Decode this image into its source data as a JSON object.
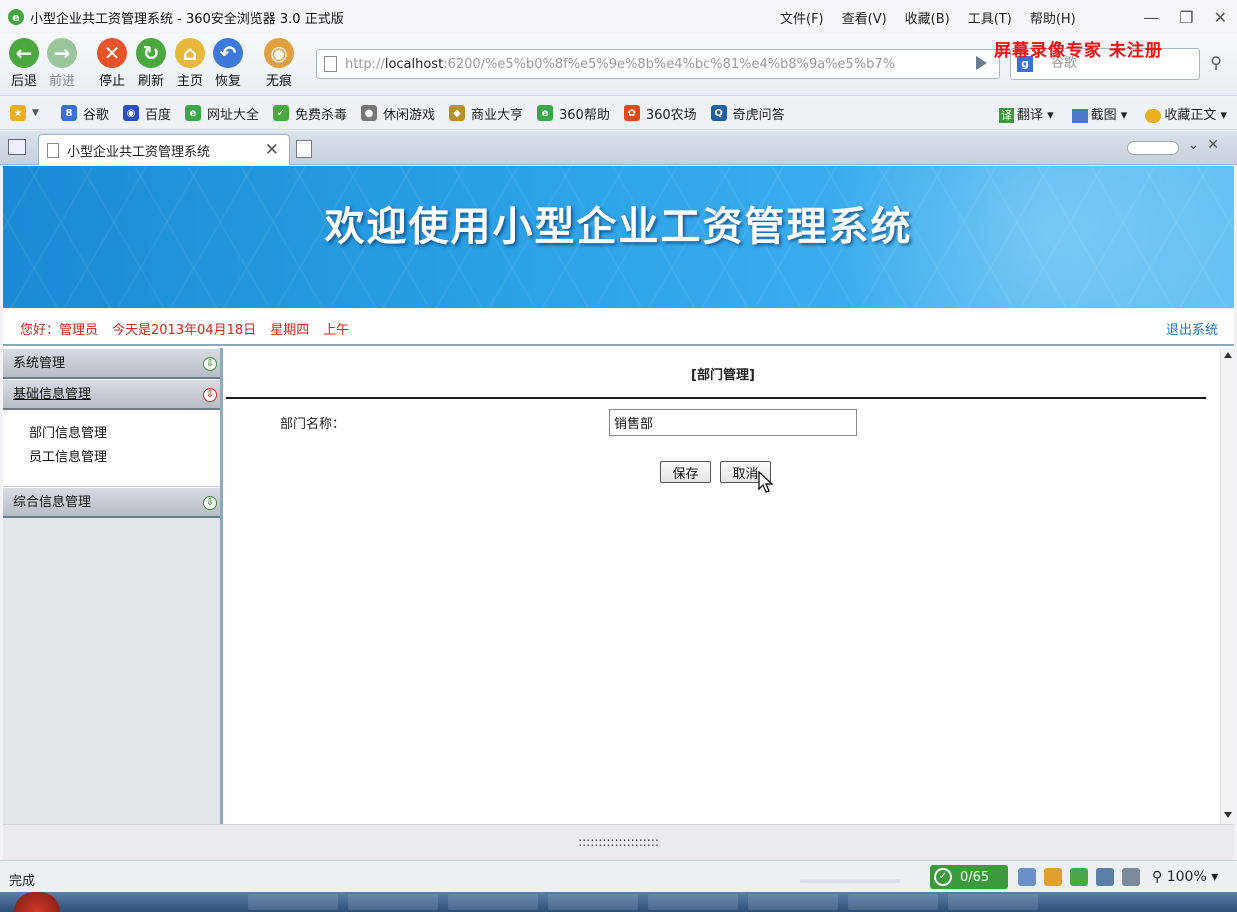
{
  "window": {
    "title": "小型企业共工资管理系统 - 360安全浏览器 3.0 正式版",
    "menus": [
      "文件(F)",
      "查看(V)",
      "收藏(B)",
      "工具(T)",
      "帮助(H)"
    ]
  },
  "toolbar": {
    "back": "后退",
    "forward": "前进",
    "stop": "停止",
    "refresh": "刷新",
    "home": "主页",
    "restore": "恢复",
    "incognito": "无痕"
  },
  "address": {
    "prefix": "http://",
    "host": "localhost",
    "rest": ":6200/%e5%b0%8f%e5%9e%8b%e4%bc%81%e4%b8%9a%e5%b7%"
  },
  "search": {
    "placeholder": "谷歌"
  },
  "watermark": "屏幕录像专家  未注册",
  "favorites": [
    "谷歌",
    "百度",
    "网址大全",
    "免费杀毒",
    "休闲游戏",
    "商业大亨",
    "360帮助",
    "360农场",
    "奇虎问答"
  ],
  "favorites_right": [
    "翻译",
    "截图",
    "收藏正文"
  ],
  "tab": {
    "label": "小型企业共工资管理系统"
  },
  "banner": {
    "title": "欢迎使用小型企业工资管理系统"
  },
  "info": {
    "greeting": "您好：管理员",
    "date": "今天是2013年04月18日",
    "weekday": "星期四",
    "period": "上午",
    "logout": "退出系统"
  },
  "menu": {
    "system": "系统管理",
    "basic": "基础信息管理",
    "basic_items": [
      "部门信息管理",
      "员工信息管理"
    ],
    "comprehensive": "综合信息管理"
  },
  "form": {
    "title": "[部门管理]",
    "dept_label": "部门名称：",
    "dept_value": "销售部",
    "save": "保存",
    "cancel": "取消"
  },
  "footer": {
    "dots": "::::::::::::::::::::"
  },
  "status": {
    "text": "完成",
    "counter": "0/65",
    "zoom": "100%"
  },
  "colors": {
    "banner": "#2aa0e6",
    "info_text": "#d0261b",
    "logout_link": "#1f7ab8",
    "watermark": "#f01010"
  }
}
